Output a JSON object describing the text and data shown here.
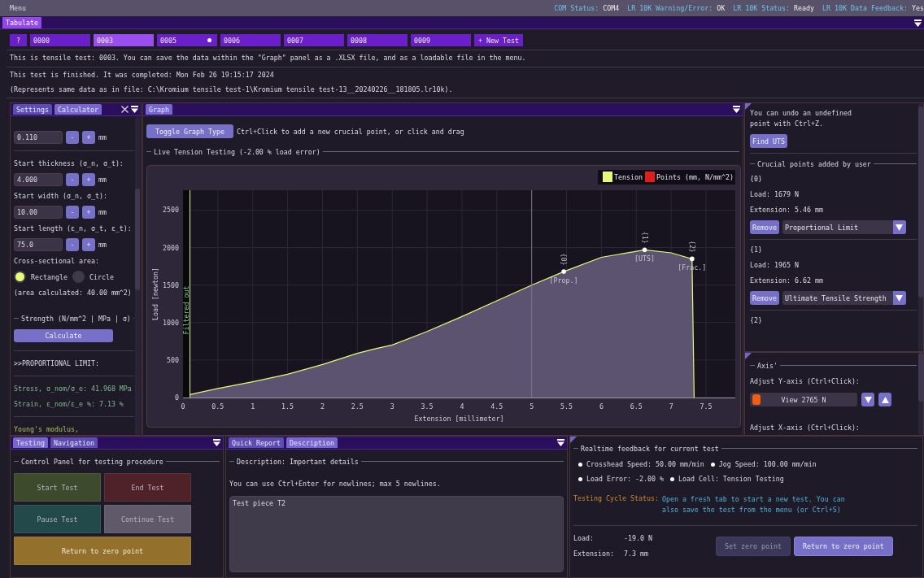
{
  "menu_bar": {
    "title": "Menu",
    "status": [
      {
        "label": "COM Status:",
        "value": "COM4"
      },
      {
        "label": "LR 10K Warning/Error:",
        "value": "OK"
      },
      {
        "label": "LR 10K Status:",
        "value": "Ready"
      },
      {
        "label": "LR 10K Data Feedback:",
        "value": "Yes"
      }
    ]
  },
  "dock": {
    "tabs": [
      {
        "label": "Tabulate",
        "selected": true
      }
    ]
  },
  "test_tabs": {
    "tabs": [
      {
        "label": "?",
        "selected": false,
        "unsaved": false
      },
      {
        "label": "0000",
        "selected": false,
        "unsaved": false
      },
      {
        "label": "0003",
        "selected": true,
        "unsaved": false
      },
      {
        "label": "0005",
        "selected": false,
        "unsaved": true
      },
      {
        "label": "0006",
        "selected": false,
        "unsaved": false
      },
      {
        "label": "0007",
        "selected": false,
        "unsaved": false
      },
      {
        "label": "0008",
        "selected": false,
        "unsaved": false
      },
      {
        "label": "0009",
        "selected": false,
        "unsaved": false
      }
    ],
    "new_test": "+ New Test"
  },
  "info": {
    "intro": "This is tensile test: 0003. You can save the data within the \"Graph\" panel as a .XLSX file, and as a loadable file in the menu.",
    "finished": "This test is finished. It was completed: Mon Feb 26 19:15:17 2024",
    "file": "(Represents same data as in file: C:\\Kromium tensile test-1\\Kromium tensile test-13__20240226__181805.lr10k)."
  },
  "calculator": {
    "tabs": [
      {
        "label": "Settings",
        "selected": false
      },
      {
        "label": "Calculator",
        "selected": true
      }
    ],
    "items": [
      {
        "kind": "field",
        "value": "0.110",
        "decrement": "-",
        "increment": "+",
        "unit": "mm"
      },
      {
        "kind": "divider"
      },
      {
        "kind": "label",
        "text": "Start thickness (σ_n, σ_t):"
      },
      {
        "kind": "field",
        "value": "4.000",
        "decrement": "-",
        "increment": "+",
        "unit": "mm"
      },
      {
        "kind": "label",
        "text": "Start width (σ_n, σ_t):"
      },
      {
        "kind": "field",
        "value": "10.00",
        "decrement": "-",
        "increment": "+",
        "unit": "mm"
      },
      {
        "kind": "label",
        "text": "Start length (ε_n, σ_t, ε_t):"
      },
      {
        "kind": "field",
        "value": "75.0",
        "decrement": "-",
        "increment": "+",
        "unit": "mm"
      },
      {
        "kind": "label",
        "text": "Cross-sectional area:"
      },
      {
        "kind": "radio",
        "options": [
          {
            "label": "Rectangle",
            "selected": true
          },
          {
            "label": "Circle",
            "selected": false
          }
        ]
      },
      {
        "kind": "label",
        "text": "(area calculated: 40.00 mm^2)"
      },
      {
        "kind": "section",
        "text": "Strength (N/mm^2 | MPa | σ)"
      },
      {
        "kind": "button",
        "text": "Calculate"
      },
      {
        "kind": "divider"
      },
      {
        "kind": "label",
        "text": ">>PROPORTIONAL LIMIT:"
      },
      {
        "kind": "divider"
      },
      {
        "kind": "result",
        "text": "Stress, σ_nom/σ_e: 41.968 MPa"
      },
      {
        "kind": "result",
        "text": "Strain, ε_nom/ε_e %: 7.13 %"
      },
      {
        "kind": "divider"
      },
      {
        "kind": "heading",
        "text": "Young's modulus,"
      }
    ]
  },
  "graph": {
    "tabs": [
      {
        "label": "Graph",
        "selected": true
      }
    ],
    "toggle_button": "Toggle Graph Type",
    "hint": "Ctrl+Click to add a new crucial point, or click and drag",
    "section": "Live Tension Testing (-2.00 % load error)",
    "points_legend": {
      "label": "Points (mm, N/mm^2)",
      "color": "#e21d1d"
    },
    "chart_data": {
      "type": "area",
      "xlabel": "Extension [millimeter]",
      "ylabel": "Load [newton]",
      "x": [
        0.1,
        0.5,
        1,
        1.5,
        2,
        2.5,
        2.75,
        3,
        3.5,
        4,
        4.5,
        5,
        5.46,
        6,
        6.62,
        7,
        7.3,
        7.33
      ],
      "series": [
        {
          "name": "Tension",
          "color": "#e4fb7a",
          "values": [
            40,
            120,
            210,
            310,
            440,
            590,
            650,
            700,
            880,
            1080,
            1290,
            1500,
            1680,
            1870,
            1970,
            1930,
            1850,
            0
          ]
        }
      ],
      "xlim": [
        0,
        7.92
      ],
      "ylim": [
        0,
        2765
      ],
      "xticks": [
        0,
        0.5,
        1,
        1.5,
        2,
        2.5,
        3,
        3.5,
        4,
        4.5,
        5,
        5.5,
        6,
        6.5,
        7,
        7.5
      ],
      "yticks": [
        0,
        500,
        1000,
        1500,
        2000,
        2500
      ],
      "grid": true,
      "bands": [
        {
          "axis": "x",
          "from": 0,
          "to": 0.1,
          "label": "Filtered out",
          "color": "#090909"
        }
      ],
      "ref_lines": [
        {
          "axis": "x",
          "value": 0.1,
          "color": "#e4fb7a"
        },
        {
          "axis": "x",
          "value": 5,
          "color": "#7d7788"
        }
      ],
      "annotations": [
        {
          "x": 5.46,
          "y": 1680,
          "text": "{0}"
        },
        {
          "x": 5.46,
          "y": 1680,
          "text": "[Prop.]"
        },
        {
          "x": 6.62,
          "y": 1970,
          "text": "{1}"
        },
        {
          "x": 6.62,
          "y": 1970,
          "text": "[UTS]"
        },
        {
          "x": 7.3,
          "y": 1850,
          "text": "{2}"
        },
        {
          "x": 7.3,
          "y": 1850,
          "text": "[Frac.]"
        }
      ]
    }
  },
  "points_panel": {
    "note": "You can undo an undefined point with Ctrl+Z.",
    "find_button": "Find UTS",
    "section": "Crucial points added by user",
    "points": [
      {
        "id": "{0}",
        "load": "Load: 1679 N",
        "extension": "Extension: 5.46 mm",
        "remove": "Remove",
        "type": "Proportional Limit"
      },
      {
        "id": "{1}",
        "load": "Load: 1965 N",
        "extension": "Extension: 6.62 mm",
        "remove": "Remove",
        "type": "Ultimate Tensile Strength"
      },
      {
        "id": "{2}"
      }
    ]
  },
  "axis_panel": {
    "section": "Axis'",
    "y_label": "Adjust Y-axis (Ctrl+Click):",
    "y_slider": {
      "value": "View 2765 N",
      "level": 0
    },
    "x_label": "Adjust X-axis (Ctrl+Click):"
  },
  "testing": {
    "tabs": [
      {
        "label": "Testing",
        "selected": true
      },
      {
        "label": "Navigation",
        "selected": false
      }
    ],
    "section": "Control Panel for testing procedure",
    "buttons": [
      {
        "label": "Start Test",
        "color": "#3d4a2c",
        "disabled": true
      },
      {
        "label": "End Test",
        "color": "#4f2229",
        "disabled": true
      },
      {
        "label": "Pause Test",
        "color": "#224a4b",
        "disabled": true
      },
      {
        "label": "Continue Test",
        "color": "#5f5969",
        "disabled": true
      },
      {
        "label": "Return to zero point",
        "color": "#93702c",
        "disabled": false
      }
    ]
  },
  "description": {
    "tabs": [
      {
        "label": "Quick Report",
        "selected": false
      },
      {
        "label": "Description",
        "selected": true
      }
    ],
    "section": "Description: Important details",
    "hint": "You can use Ctrl+Enter for newlines; max 5 newlines.",
    "text": "Test piece T2"
  },
  "feedback": {
    "section": "Realtime feedback for current test",
    "bullets": [
      "Crosshead Speed: 50.00 mm/min",
      "Jog Speed: 100.00 mm/min",
      "Load Error: -2.00 %",
      "Load Cell: Tension Testing"
    ],
    "status_label": "Testing Cycle Status:",
    "status": "Open a fresh tab to start a new test. You can also save the test from the menu (or Ctrl+S)",
    "readings": [
      {
        "label": "Load:",
        "value": "-19.0 N"
      },
      {
        "label": "Extension:",
        "value": "7.3 mm"
      }
    ],
    "buttons": [
      {
        "label": "Set zero point",
        "disabled": true
      },
      {
        "label": "Return to zero point",
        "disabled": false
      }
    ]
  }
}
